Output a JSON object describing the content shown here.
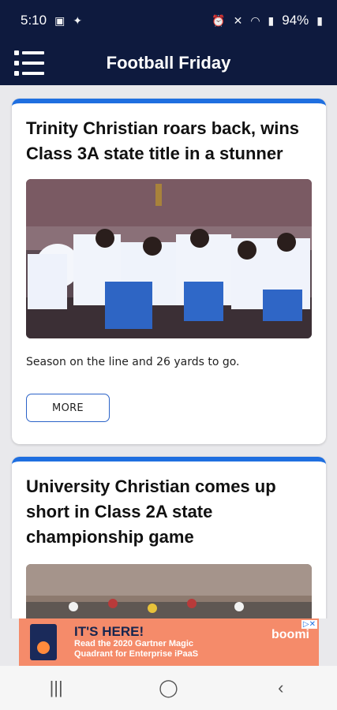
{
  "status": {
    "time": "5:10",
    "battery": "94%"
  },
  "app": {
    "title": "Football Friday"
  },
  "articles": [
    {
      "title": "Trinity Christian roars back, wins Class 3A state title in a stunner",
      "description": "Season on the line and 26 yards to go.",
      "more_label": "MORE"
    },
    {
      "title": "University Christian comes up short in Class 2A state championship game"
    }
  ],
  "ad": {
    "headline": "IT'S HERE!",
    "body_line1": "Read the 2020 Gartner Magic",
    "body_line2": "Quadrant for Enterprise iPaaS",
    "brand": "boomi"
  },
  "icons": {
    "menu": "menu-icon",
    "recents": "recents-icon",
    "home": "home-icon",
    "back": "back-icon"
  },
  "colors": {
    "header_bg": "#0e1a3e",
    "accent": "#1f6fe0",
    "ad_bg": "#f58b6a"
  }
}
